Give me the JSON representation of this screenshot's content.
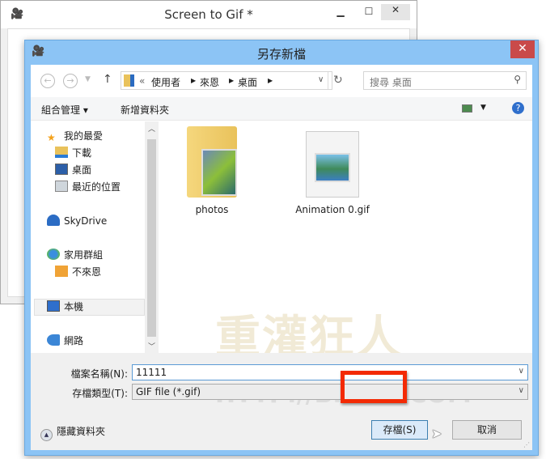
{
  "background_window": {
    "title": "Screen to Gif *",
    "minimize": "▁",
    "maximize": "☐",
    "close": "✕"
  },
  "dialog": {
    "title": "另存新檔",
    "close": "✕",
    "nav": {
      "back": "←",
      "forward": "→",
      "up": "↑",
      "breadcrumb": [
        "«",
        "使用者",
        "來恩",
        "桌面"
      ],
      "refresh": "↻",
      "search_placeholder": "搜尋 桌面"
    },
    "toolbar": {
      "organize": "組合管理 ▾",
      "new_folder": "新增資料夾",
      "help": "?"
    },
    "sidebar": {
      "items": [
        {
          "label": "我的最愛",
          "icon": "star-icon"
        },
        {
          "label": "下載",
          "icon": "downloads-icon"
        },
        {
          "label": "桌面",
          "icon": "desktop-icon"
        },
        {
          "label": "最近的位置",
          "icon": "recent-places-icon"
        },
        {
          "label": "SkyDrive",
          "icon": "skydrive-icon"
        },
        {
          "label": "家用群組",
          "icon": "homegroup-icon"
        },
        {
          "label": "不來恩",
          "icon": "user-icon"
        },
        {
          "label": "本機",
          "icon": "computer-icon"
        },
        {
          "label": "網路",
          "icon": "network-icon"
        }
      ]
    },
    "files": [
      {
        "name": "photos",
        "icon": "folder-icon"
      },
      {
        "name": "Animation 0.gif",
        "icon": "image-file-icon"
      }
    ],
    "filename_label": "檔案名稱(N):",
    "filename_value": "11111",
    "filetype_label": "存檔類型(T):",
    "filetype_value": "GIF file (*.gif)",
    "hide_folders": "隱藏資料夾",
    "save": "存檔(S)",
    "cancel": "取消"
  },
  "watermark": {
    "line1": "重灌狂人",
    "line2": "HTTP://BRIAN.COM"
  },
  "colors": {
    "titlebar": "#8cc4f5",
    "close": "#c94a4a",
    "highlight": "#f32a05"
  }
}
